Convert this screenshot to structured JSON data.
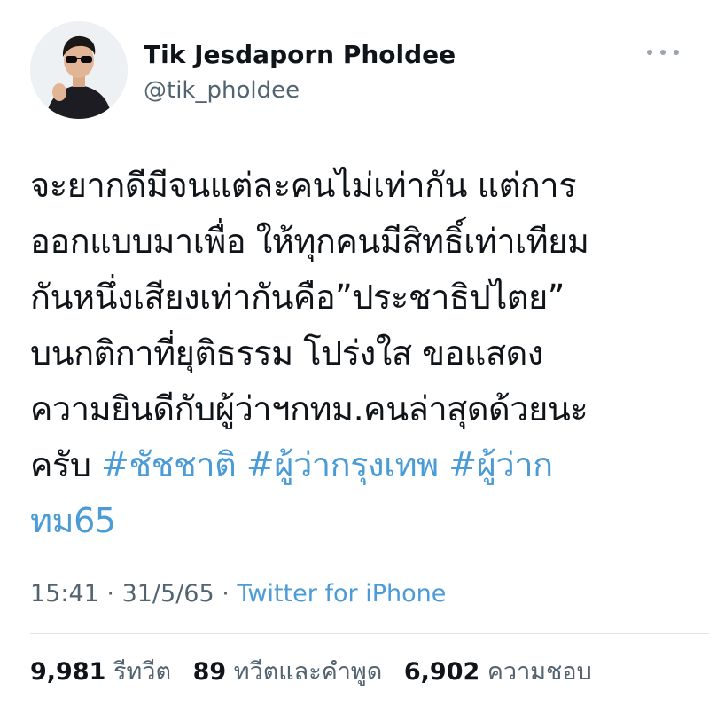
{
  "author": {
    "display_name": "Tik Jesdaporn Pholdee",
    "handle": "@tik_pholdee"
  },
  "tweet": {
    "lines": [
      [
        {
          "text": "จะยากดีมีจนแต่ละคนไม่เท่ากัน แต่การ",
          "type": "text"
        }
      ],
      [
        {
          "text": "ออกแบบมาเพื่อ ให้ทุกคนมีสิทธิ์เท่าเทียม",
          "type": "text"
        }
      ],
      [
        {
          "text": "กันหนึ่งเสียงเท่ากันคือ”ประชาธิปไตย”",
          "type": "text"
        }
      ],
      [
        {
          "text": "บนกติกาที่ยุติธรรม โปร่งใส ขอแสดง",
          "type": "text"
        }
      ],
      [
        {
          "text": "ความยินดีกับผู้ว่าฯกทม.คนล่าสุดด้วยนะ",
          "type": "text"
        }
      ],
      [
        {
          "text": "ครับ ",
          "type": "text"
        },
        {
          "text": "#ชัชชาติ",
          "type": "hashtag"
        },
        {
          "text": " ",
          "type": "text"
        },
        {
          "text": "#ผู้ว่ากรุงเทพ",
          "type": "hashtag"
        },
        {
          "text": " ",
          "type": "text"
        },
        {
          "text": "#ผู้ว่าก",
          "type": "hashtag"
        }
      ],
      [
        {
          "text": "ทม65",
          "type": "hashtag"
        }
      ]
    ]
  },
  "meta": {
    "time": "15:41",
    "separator": " · ",
    "date": "31/5/65",
    "separator2": " · ",
    "source": "Twitter for iPhone"
  },
  "stats": {
    "retweets": {
      "count": "9,981",
      "label": "รีทวีต"
    },
    "quotes": {
      "count": "89",
      "label": "ทวีตและคำพูด"
    },
    "likes": {
      "count": "6,902",
      "label": "ความชอบ"
    }
  },
  "colors": {
    "link": "#4a9bd6",
    "text": "#0f1419",
    "secondary": "#536471"
  },
  "icons": {
    "more": "more-horizontal-icon"
  }
}
